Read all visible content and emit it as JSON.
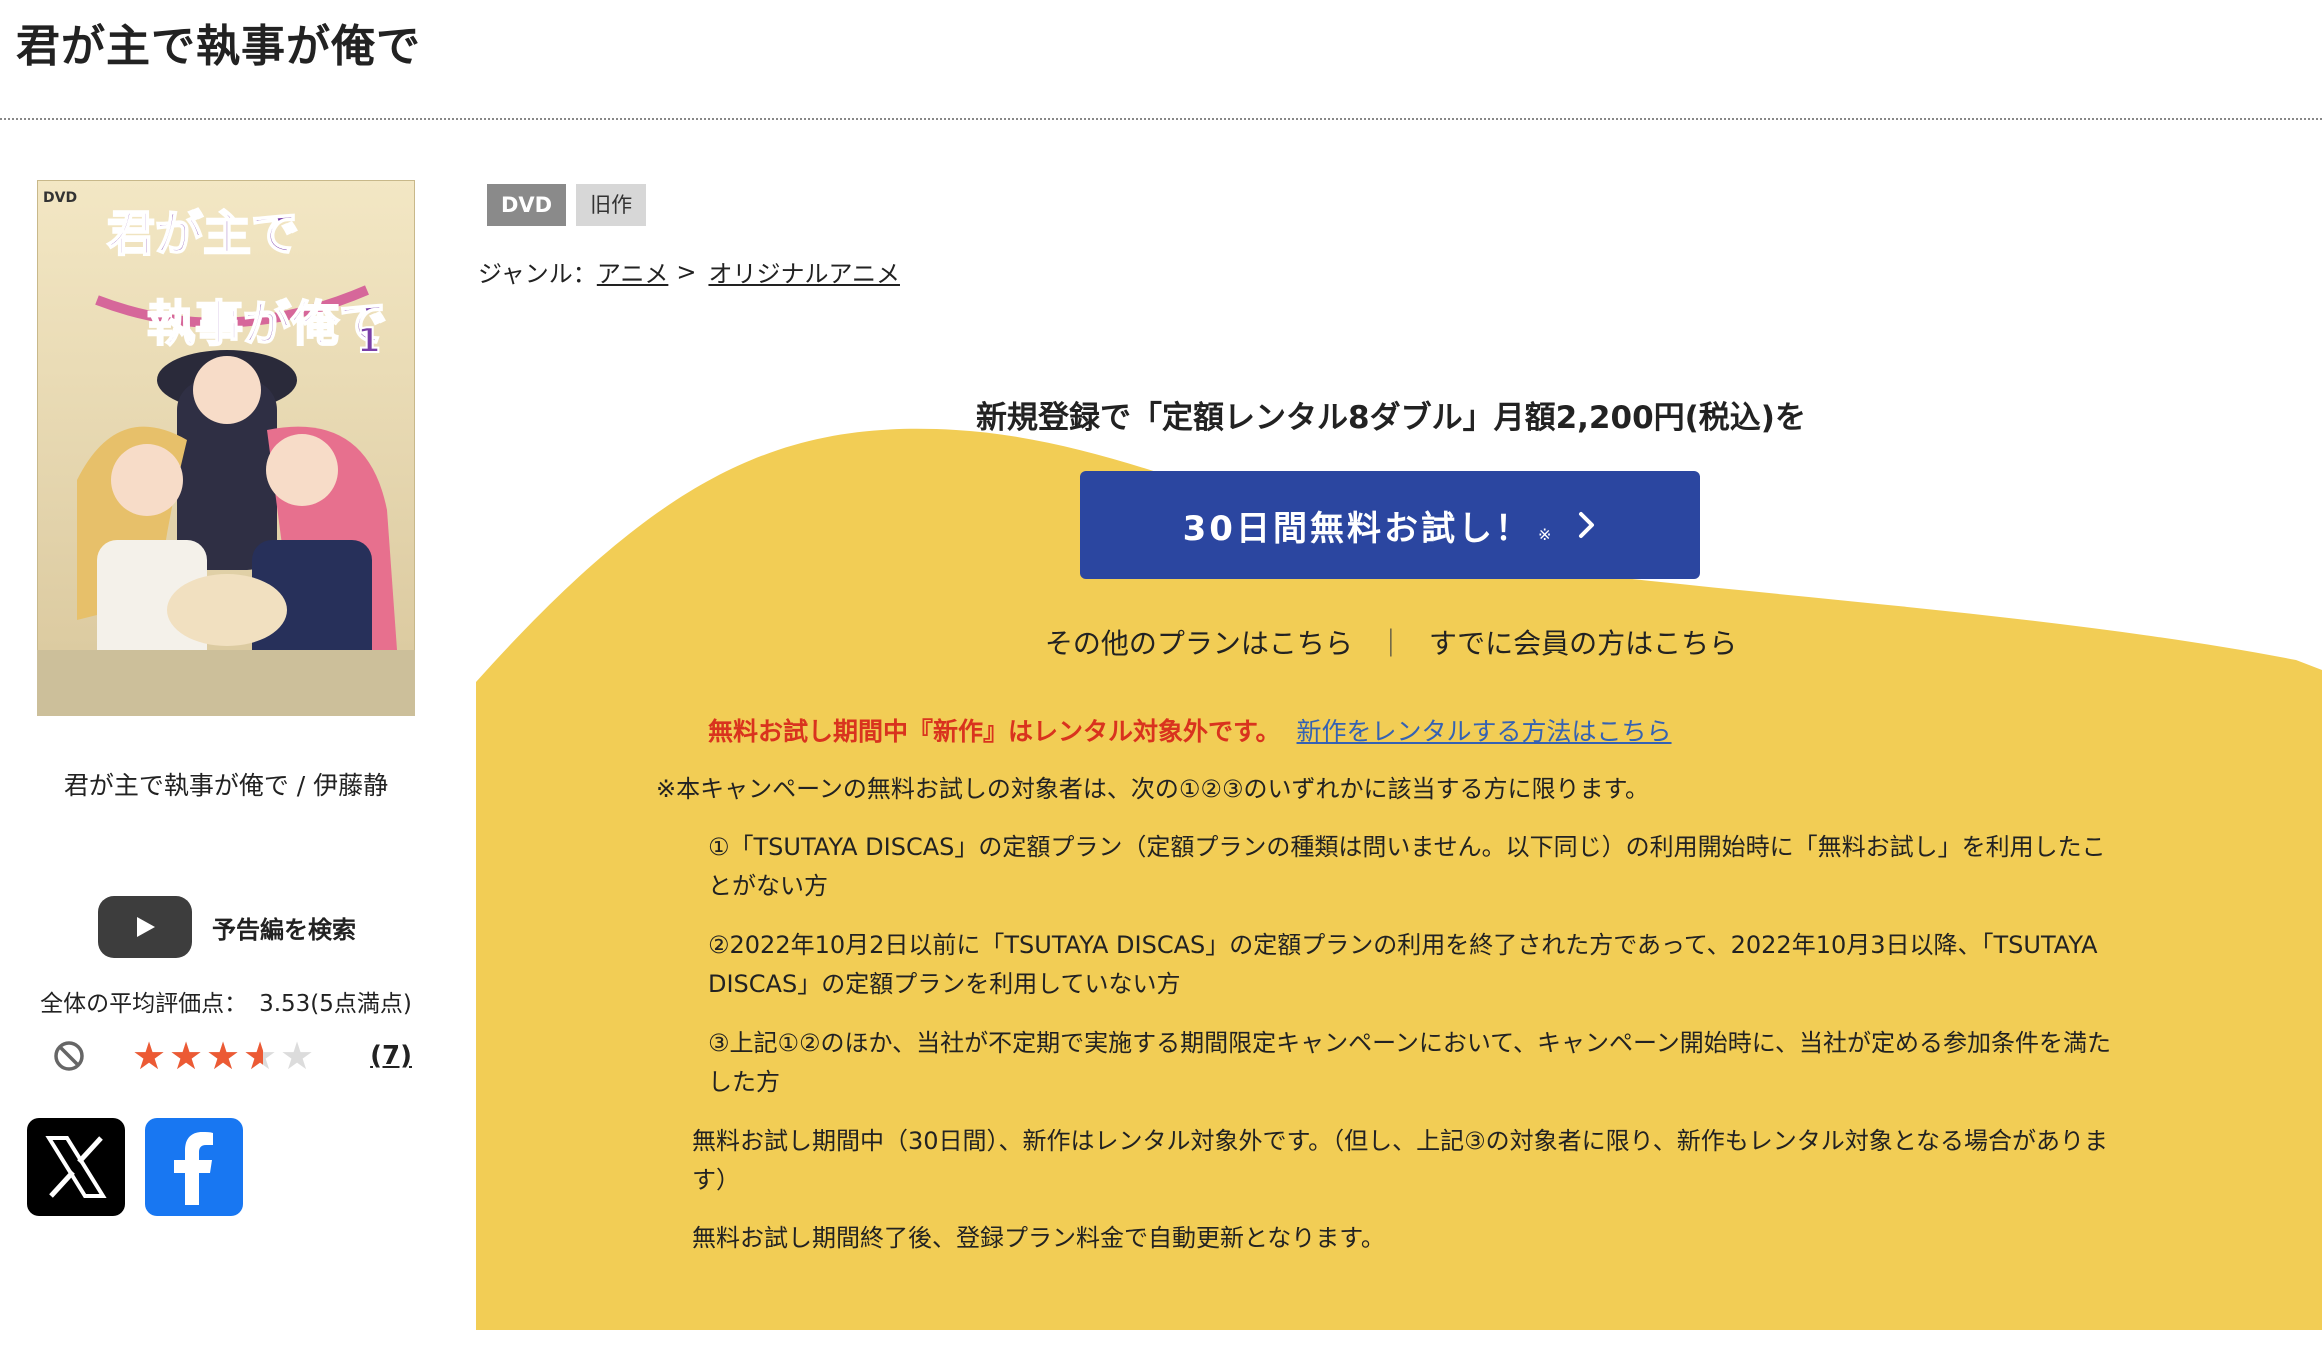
{
  "page": {
    "title": "君が主で執事が俺で"
  },
  "product": {
    "cover_title_line1": "君が主で",
    "cover_title_line2": "執事が俺で",
    "cover_dvd_mark": "DVD",
    "cover_volume": "1",
    "name": "君が主で執事が俺で / 伊藤静"
  },
  "trailer": {
    "label": "予告編を検索"
  },
  "rating": {
    "label": "全体の平均評価点：",
    "value": "3.53(5点満点)",
    "score": 3.53,
    "max": 5,
    "review_count": "(7)"
  },
  "social": {
    "x": "X",
    "facebook": "f"
  },
  "tags": [
    "DVD",
    "旧作"
  ],
  "genre": {
    "label": "ジャンル：",
    "items": [
      "アニメ",
      "オリジナルアニメ"
    ],
    "separator": ">"
  },
  "promo": {
    "headline": "新規登録で「定額レンタル8ダブル」月額2,200円(税込)を",
    "trial_button_label": "30日間無料お試し！",
    "trial_button_mark": "※",
    "other_plans": "その他のプランはこちら",
    "divider": "｜",
    "members": "すでに会員の方はこちら",
    "notice_red": "無料お試し期間中『新作』はレンタル対象外です。",
    "notice_link": "新作をレンタルする方法はこちら",
    "conditions_intro": "※本キャンペーンの無料お試しの対象者は、次の①②③のいずれかに該当する方に限ります。",
    "conditions": [
      "①「TSUTAYA DISCAS」の定額プラン（定額プランの種類は問いません。以下同じ）の利用開始時に「無料お試し」を利用したことがない方",
      "②2022年10月2日以前に「TSUTAYA DISCAS」の定額プランの利用を終了された方であって、2022年10月3日以降、「TSUTAYA DISCAS」の定額プランを利用していない方",
      "③上記①②のほか、当社が不定期で実施する期間限定キャンペーンにおいて、キャンペーン開始時に、当社が定める参加条件を満たした方"
    ],
    "note1": "無料お試し期間中（30日間）、新作はレンタル対象外です。（但し、上記③の対象者に限り、新作もレンタル対象となる場合があります）",
    "note2": "無料お試し期間終了後、登録プラン料金で自動更新となります。"
  },
  "colors": {
    "accent_blue": "#2b46a0",
    "promo_yellow": "#f2cd55",
    "star_orange": "#ec5a34",
    "notice_red": "#d9331e",
    "link_blue": "#3562b3"
  }
}
